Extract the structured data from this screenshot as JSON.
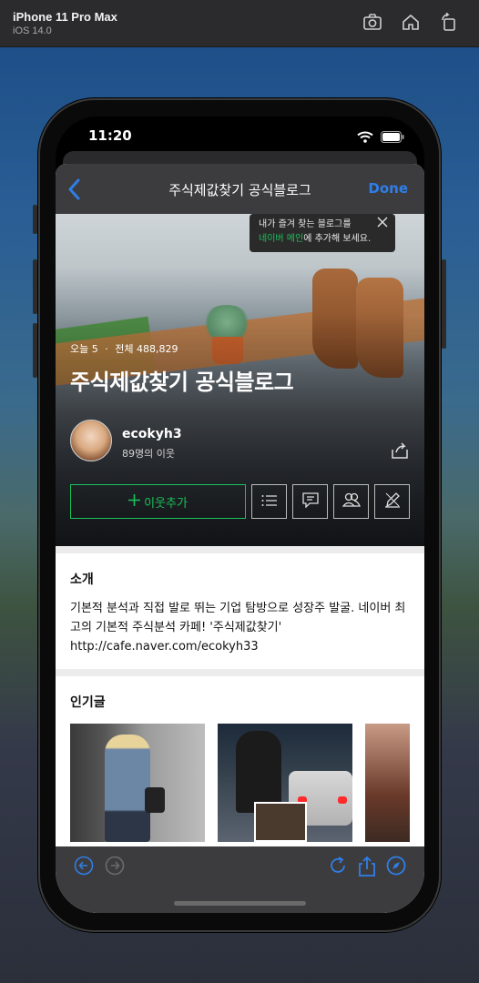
{
  "simulator": {
    "device": "iPhone 11 Pro Max",
    "os": "iOS 14.0"
  },
  "status_bar": {
    "time": "11:20"
  },
  "navbar": {
    "title": "주식제값찾기 공식블로그",
    "done": "Done"
  },
  "tooltip": {
    "line1": "내가 즐겨 찾는 블로그를",
    "line2_green": "네이버 메인",
    "line2_rest": "에 추가해 보세요."
  },
  "blog": {
    "today_label": "오늘 5",
    "separator": "·",
    "total_label": "전체 488,829",
    "title": "주식제값찾기 공식블로그",
    "username": "ecokyh3",
    "neighbors": "89명의 이웃",
    "add_neighbor": "이웃추가"
  },
  "intro": {
    "heading": "소개",
    "text": "기본적 분석과 직접 발로 뛰는 기업 탐방으로 성장주 발굴.   네이버 최고의 기본적 주식분석 카페!   '주식제값찾기' http://cafe.naver.com/ecokyh33"
  },
  "popular": {
    "heading": "인기글"
  },
  "colors": {
    "accent": "#2f7ee8",
    "naver_green": "#19c25a",
    "nav_bg": "#3c3c3e"
  },
  "icons": [
    "camera-icon",
    "home-icon",
    "rotate-icon",
    "back-chevron-icon",
    "close-icon",
    "share-icon",
    "plus-icon",
    "list-icon",
    "comment-icon",
    "people-icon",
    "edit-icon",
    "back-arrow-icon",
    "forward-arrow-icon",
    "reload-icon",
    "share-sheet-icon",
    "safari-compass-icon"
  ]
}
